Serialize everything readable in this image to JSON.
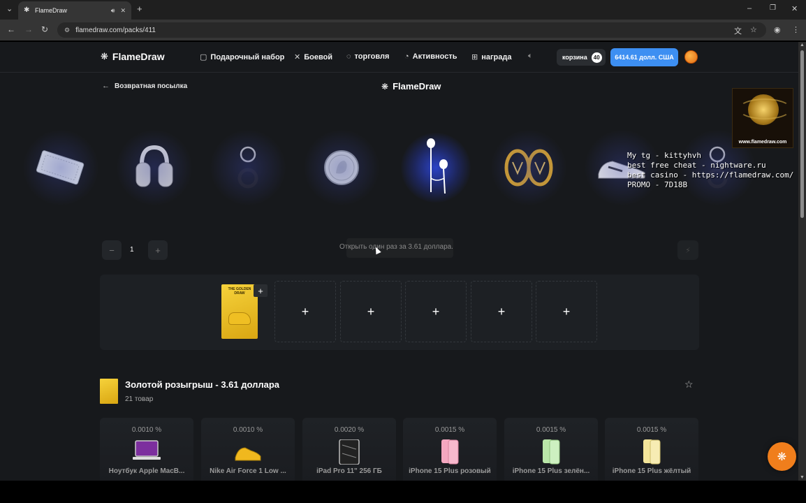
{
  "browser": {
    "tab_title": "FlameDraw",
    "url": "flamedraw.com/packs/411"
  },
  "header": {
    "logo": "FlameDraw",
    "nav": [
      {
        "label": "Подарочный набор",
        "icon": "gift-box-icon"
      },
      {
        "label": "Боевой",
        "icon": "crossed-swords-icon"
      },
      {
        "label": "торговля",
        "icon": "trade-icon"
      },
      {
        "label": "Активность",
        "icon": "activity-icon"
      },
      {
        "label": "награда",
        "icon": "reward-icon"
      }
    ],
    "cart_label": "корзина",
    "cart_count": "40",
    "balance": "6414.61 долл. США"
  },
  "sub": {
    "back_label": "Возвратная посылка",
    "center_logo": "FlameDraw"
  },
  "carousel": {
    "items": [
      "coupon-ticket",
      "headphones",
      "keychain",
      "silver-coin",
      "earphones",
      "gold-earrings",
      "sneakers",
      "keychain"
    ]
  },
  "watermark": {
    "text": "www.flamedraw.com"
  },
  "overlay": {
    "lines": [
      "My tg - kittyhvh",
      "best free cheat - nightware.ru",
      "best casino - https://flamedraw.com/",
      "PROMO - 7D18B"
    ]
  },
  "controls": {
    "minus": "−",
    "quantity": "1",
    "plus": "+",
    "open_label": "Открыть один раз за 3.61 доллара."
  },
  "pack_card": {
    "title": "THE GOLDEN DRAW"
  },
  "slots": [
    "+",
    "+",
    "+",
    "+",
    "+"
  ],
  "pack": {
    "title": "Золотой розыгрыш - 3.61 доллара",
    "count": "21 товар"
  },
  "products": [
    {
      "chance": "0.0010 %",
      "name": "Ноутбук Apple MacB..."
    },
    {
      "chance": "0.0010 %",
      "name": "Nike Air Force 1 Low ..."
    },
    {
      "chance": "0.0020 %",
      "name": "iPad Pro 11\" 256 ГБ"
    },
    {
      "chance": "0.0015 %",
      "name": "iPhone 15 Plus розовый"
    },
    {
      "chance": "0.0015 %",
      "name": "iPhone 15 Plus зелён..."
    },
    {
      "chance": "0.0015 %",
      "name": "iPhone 15 Plus жёлтый"
    }
  ],
  "colors": {
    "accent": "#3d8ff2",
    "fab": "#f07e1c",
    "background": "#17191c"
  }
}
